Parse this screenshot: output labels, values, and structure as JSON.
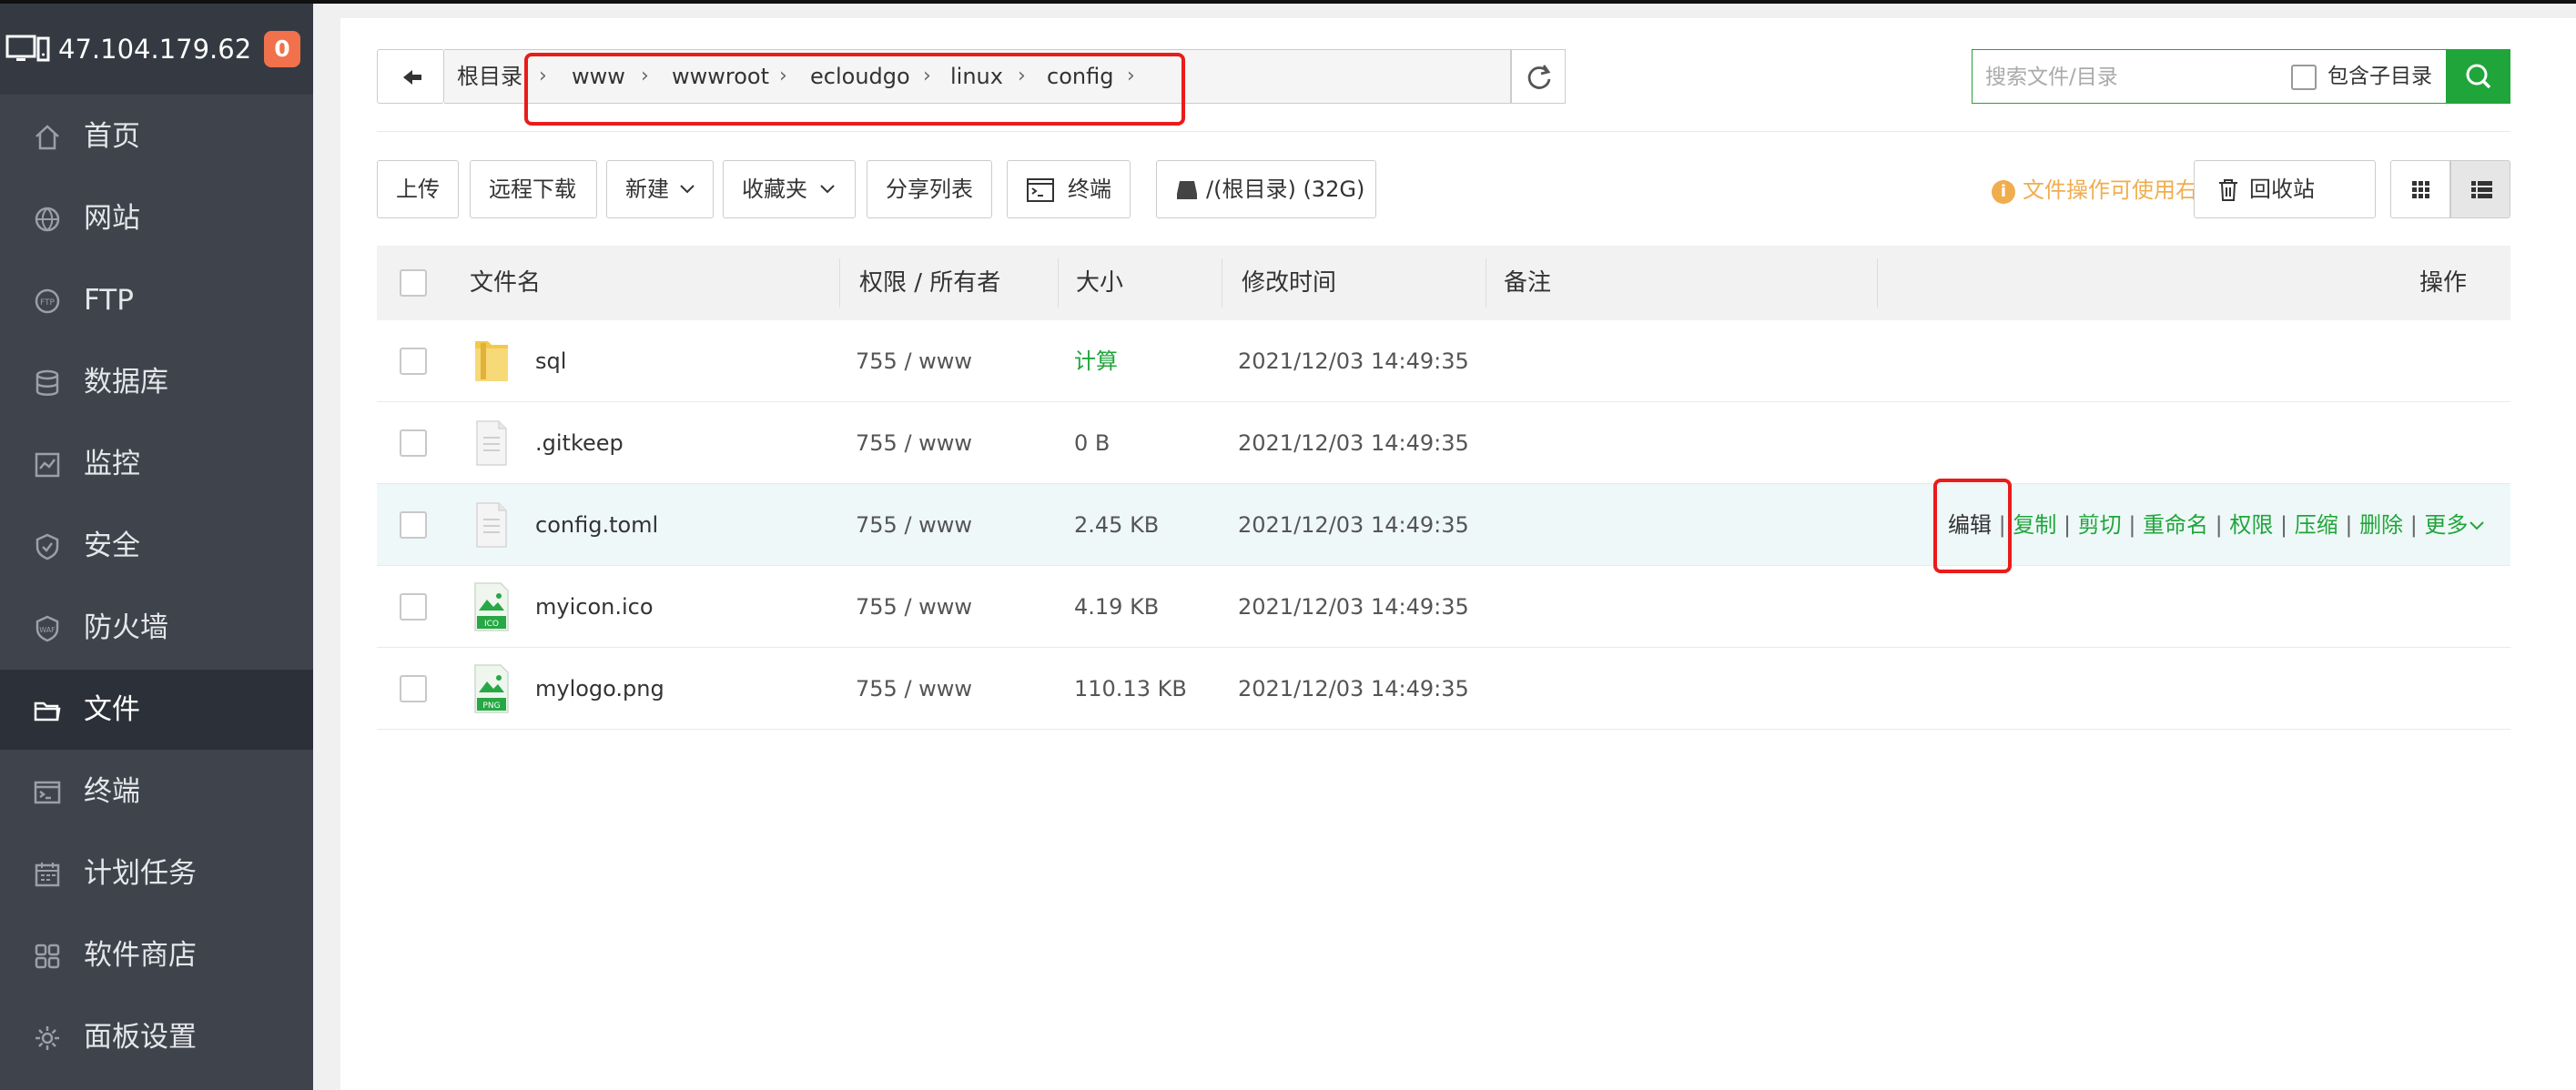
{
  "sidebar": {
    "server_ip": "47.104.179.62",
    "badge": "0",
    "items": [
      {
        "label": "首页",
        "icon": "home-icon"
      },
      {
        "label": "网站",
        "icon": "globe-icon"
      },
      {
        "label": "FTP",
        "icon": "ftp-icon"
      },
      {
        "label": "数据库",
        "icon": "database-icon"
      },
      {
        "label": "监控",
        "icon": "monitor-icon"
      },
      {
        "label": "安全",
        "icon": "shield-icon"
      },
      {
        "label": "防火墙",
        "icon": "firewall-icon"
      },
      {
        "label": "文件",
        "icon": "folder-icon",
        "active": true
      },
      {
        "label": "终端",
        "icon": "terminal-icon"
      },
      {
        "label": "计划任务",
        "icon": "calendar-icon"
      },
      {
        "label": "软件商店",
        "icon": "apps-icon"
      },
      {
        "label": "面板设置",
        "icon": "settings-icon"
      }
    ]
  },
  "breadcrumb": {
    "root": "根目录",
    "segments": [
      "www",
      "wwwroot",
      "ecloudgo",
      "linux",
      "config"
    ]
  },
  "search": {
    "placeholder": "搜索文件/目录",
    "include_subdirs_label": "包含子目录",
    "include_subdirs_checked": false
  },
  "toolbar": {
    "upload": "上传",
    "remote_download": "远程下载",
    "new": "新建",
    "favorites": "收藏夹",
    "share_list": "分享列表",
    "terminal": "终端",
    "disk": "/(根目录) (32G)",
    "hint": "文件操作可使用右键",
    "recycle": "回收站"
  },
  "table": {
    "headers": {
      "name": "文件名",
      "perm": "权限 / 所有者",
      "size": "大小",
      "mtime": "修改时间",
      "note": "备注",
      "ops": "操作"
    },
    "rows": [
      {
        "name": "sql",
        "type": "folder",
        "perm": "755 / www",
        "size": "计算",
        "mtime": "2021/12/03 14:49:35"
      },
      {
        "name": ".gitkeep",
        "type": "file",
        "perm": "755 / www",
        "size": "0 B",
        "mtime": "2021/12/03 14:49:35"
      },
      {
        "name": "config.toml",
        "type": "file",
        "perm": "755 / www",
        "size": "2.45 KB",
        "mtime": "2021/12/03 14:49:35",
        "highlighted": true
      },
      {
        "name": "myicon.ico",
        "type": "image",
        "badge": "ICO",
        "perm": "755 / www",
        "size": "4.19 KB",
        "mtime": "2021/12/03 14:49:35"
      },
      {
        "name": "mylogo.png",
        "type": "image",
        "badge": "PNG",
        "perm": "755 / www",
        "size": "110.13 KB",
        "mtime": "2021/12/03 14:49:35"
      }
    ],
    "row_actions": [
      "编辑",
      "复制",
      "剪切",
      "重命名",
      "权限",
      "压缩",
      "删除",
      "更多"
    ]
  },
  "colors": {
    "sidebar_bg": "#3e434c",
    "sidebar_active": "#2c3038",
    "accent_green": "#20a53a",
    "hint_orange": "#f0ad4e",
    "badge_orange": "#f0714b",
    "annotation_red": "#ea1b1b"
  }
}
